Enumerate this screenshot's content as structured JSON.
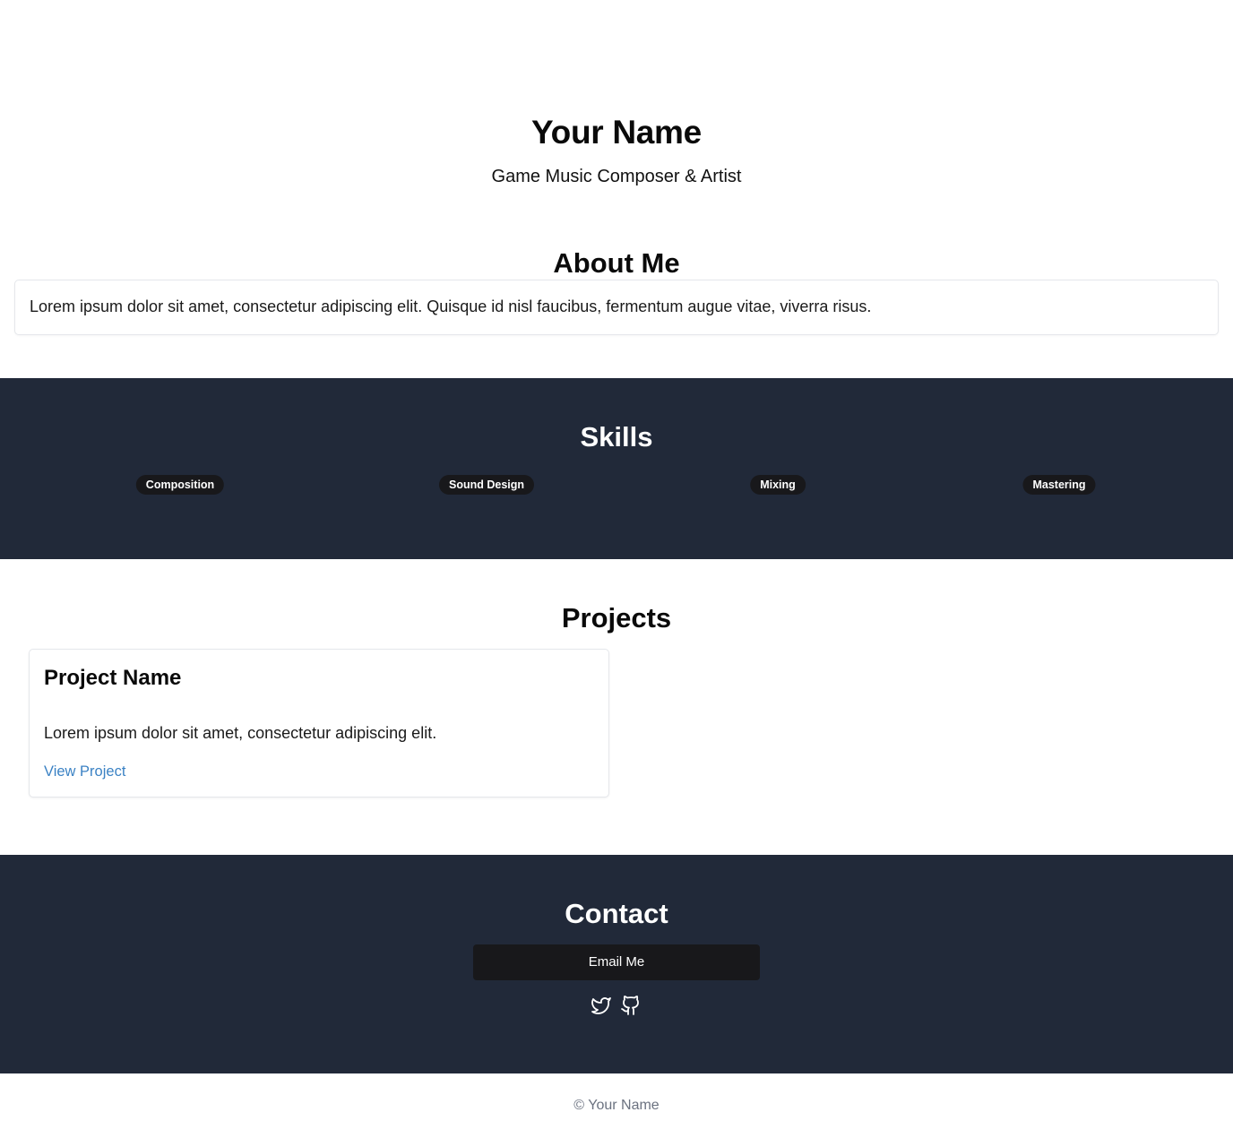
{
  "hero": {
    "name": "Your Name",
    "subtitle": "Game Music Composer & Artist"
  },
  "about": {
    "title": "About Me",
    "text": "Lorem ipsum dolor sit amet, consectetur adipiscing elit. Quisque id nisl faucibus, fermentum augue vitae, viverra risus."
  },
  "skills": {
    "title": "Skills",
    "items": [
      "Composition",
      "Sound Design",
      "Mixing",
      "Mastering"
    ]
  },
  "projects": {
    "title": "Projects",
    "items": [
      {
        "name": "Project Name",
        "description": "Lorem ipsum dolor sit amet, consectetur adipiscing elit.",
        "link_label": "View Project"
      }
    ]
  },
  "contact": {
    "title": "Contact",
    "email_label": "Email Me",
    "social_icons": [
      "twitter-icon",
      "github-icon"
    ]
  },
  "footer": {
    "text": "© Your Name"
  },
  "colors": {
    "dark_section": "#212939",
    "badge_bg": "#18181b",
    "link": "#3b82c4",
    "footer_text": "#6b7280"
  }
}
